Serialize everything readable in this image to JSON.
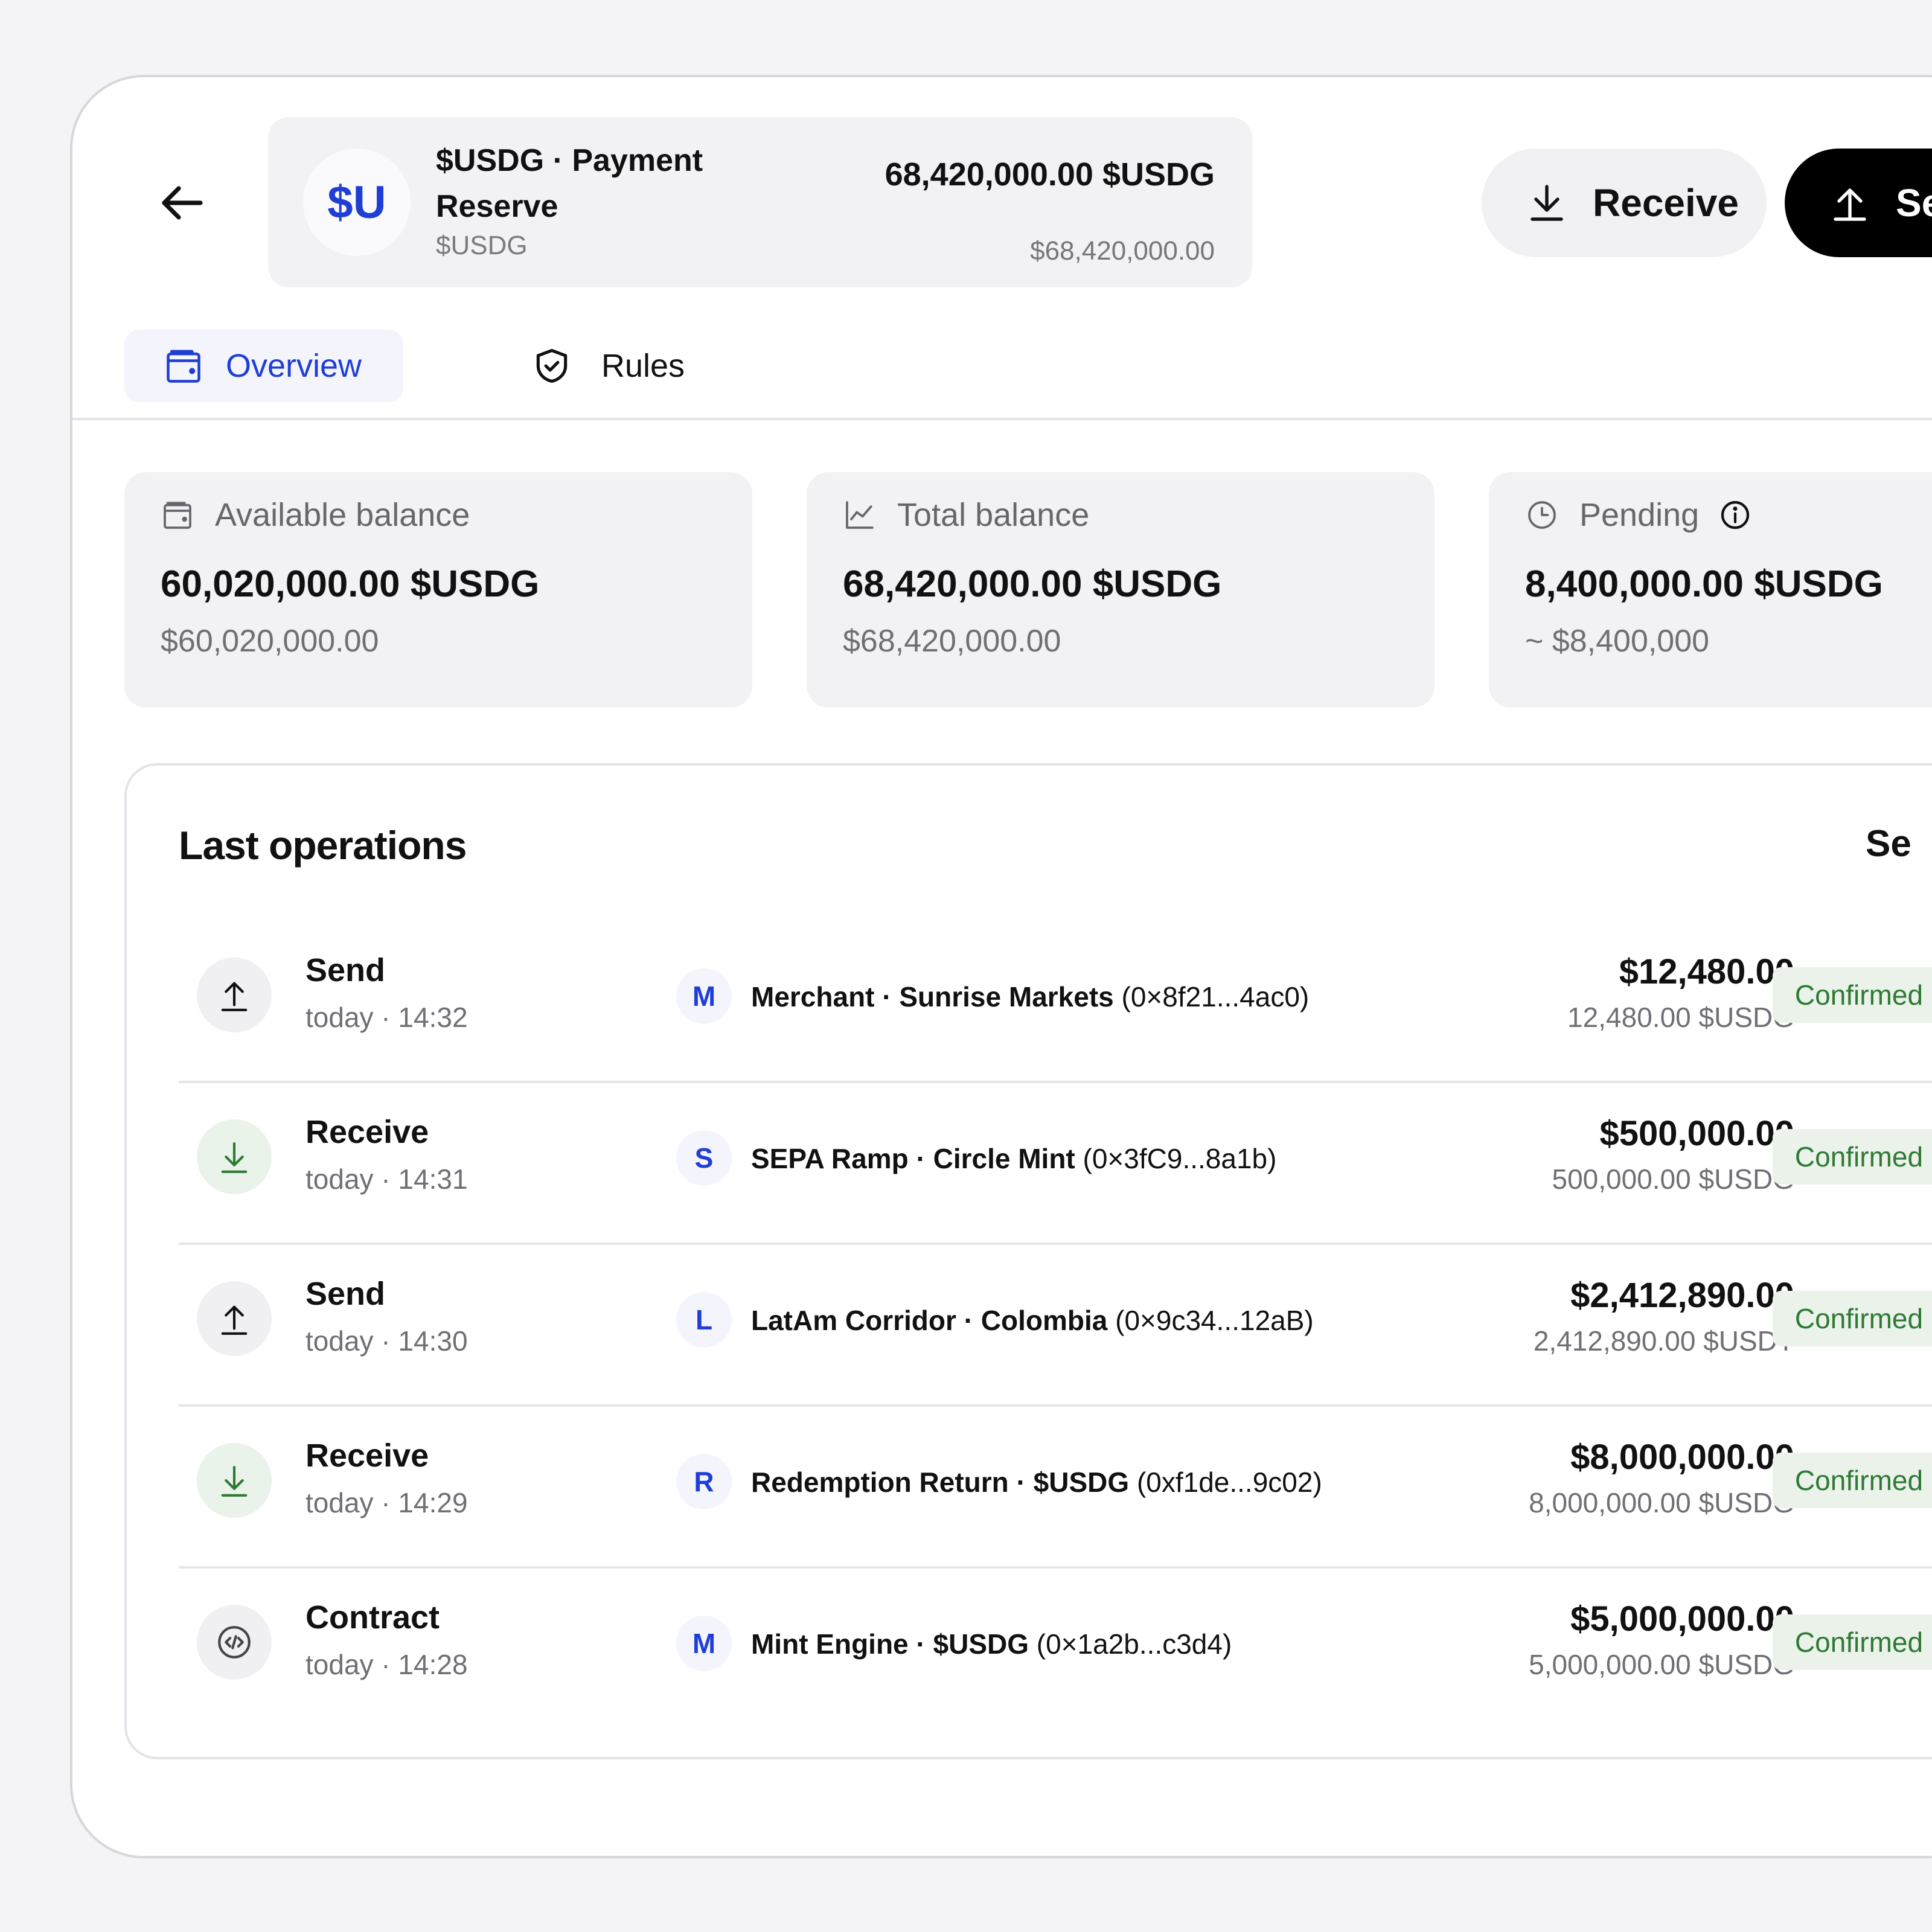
{
  "header": {
    "asset": {
      "avatar_text": "$U",
      "name": "$USDG · Payment Reserve",
      "symbol": "$USDG",
      "amount": "68,420,000.00 $USDG",
      "usd_value": "$68,420,000.00"
    },
    "receive_label": "Receive",
    "send_label": "Se"
  },
  "tabs": [
    {
      "label": "Overview",
      "active": true,
      "icon": "wallet-icon"
    },
    {
      "label": "Rules",
      "active": false,
      "icon": "shield-check-icon"
    }
  ],
  "stats": [
    {
      "label": "Available balance",
      "icon": "wallet-icon",
      "value": "60,020,000.00 $USDG",
      "usd": "$60,020,000.00"
    },
    {
      "label": "Total balance",
      "icon": "chart-line-icon",
      "value": "68,420,000.00 $USDG",
      "usd": "$68,420,000.00"
    },
    {
      "label": "Pending",
      "icon": "clock-icon",
      "info_icon": "info-icon",
      "value": "8,400,000.00 $USDG",
      "usd": "~ $8,400,000"
    }
  ],
  "operations": {
    "title": "Last operations",
    "see_all": "Se",
    "rows": [
      {
        "type": "Send",
        "time": "today · 14:32",
        "icon": "upload-arrow-icon",
        "cp_initial": "M",
        "cp_name": "Merchant · Sunrise Markets",
        "cp_addr": "(0×8f21...4ac0)",
        "amount": "$12,480.00",
        "token_amount": "12,480.00 $USDG",
        "status": "Confirmed"
      },
      {
        "type": "Receive",
        "time": "today · 14:31",
        "icon": "download-arrow-icon",
        "cp_initial": "S",
        "cp_name": "SEPA Ramp · Circle Mint",
        "cp_addr": "(0×3fC9...8a1b)",
        "amount": "$500,000.00",
        "token_amount": "500,000.00 $USDG",
        "status": "Confirmed"
      },
      {
        "type": "Send",
        "time": "today · 14:30",
        "icon": "upload-arrow-icon",
        "cp_initial": "L",
        "cp_name": "LatAm Corridor · Colombia",
        "cp_addr": "(0×9c34...12aB)",
        "amount": "$2,412,890.00",
        "token_amount": "2,412,890.00 $USDT",
        "status": "Confirmed"
      },
      {
        "type": "Receive",
        "time": "today · 14:29",
        "icon": "download-arrow-icon",
        "cp_initial": "R",
        "cp_name": "Redemption Return · $USDG",
        "cp_addr": "(0xf1de...9c02)",
        "amount": "$8,000,000.00",
        "token_amount": "8,000,000.00 $USDG",
        "status": "Confirmed"
      },
      {
        "type": "Contract",
        "time": "today · 14:28",
        "icon": "code-icon",
        "cp_initial": "M",
        "cp_name": "Mint Engine · $USDG",
        "cp_addr": "(0×1a2b...c3d4)",
        "amount": "$5,000,000.00",
        "token_amount": "5,000,000.00 $USDG",
        "status": "Confirmed"
      }
    ]
  },
  "colors": {
    "accent": "#1f3ed6",
    "success_text": "#2e7a34",
    "success_bg": "#eaf2ea",
    "surface": "#f2f1f3",
    "page_bg": "#f4f3f6"
  }
}
